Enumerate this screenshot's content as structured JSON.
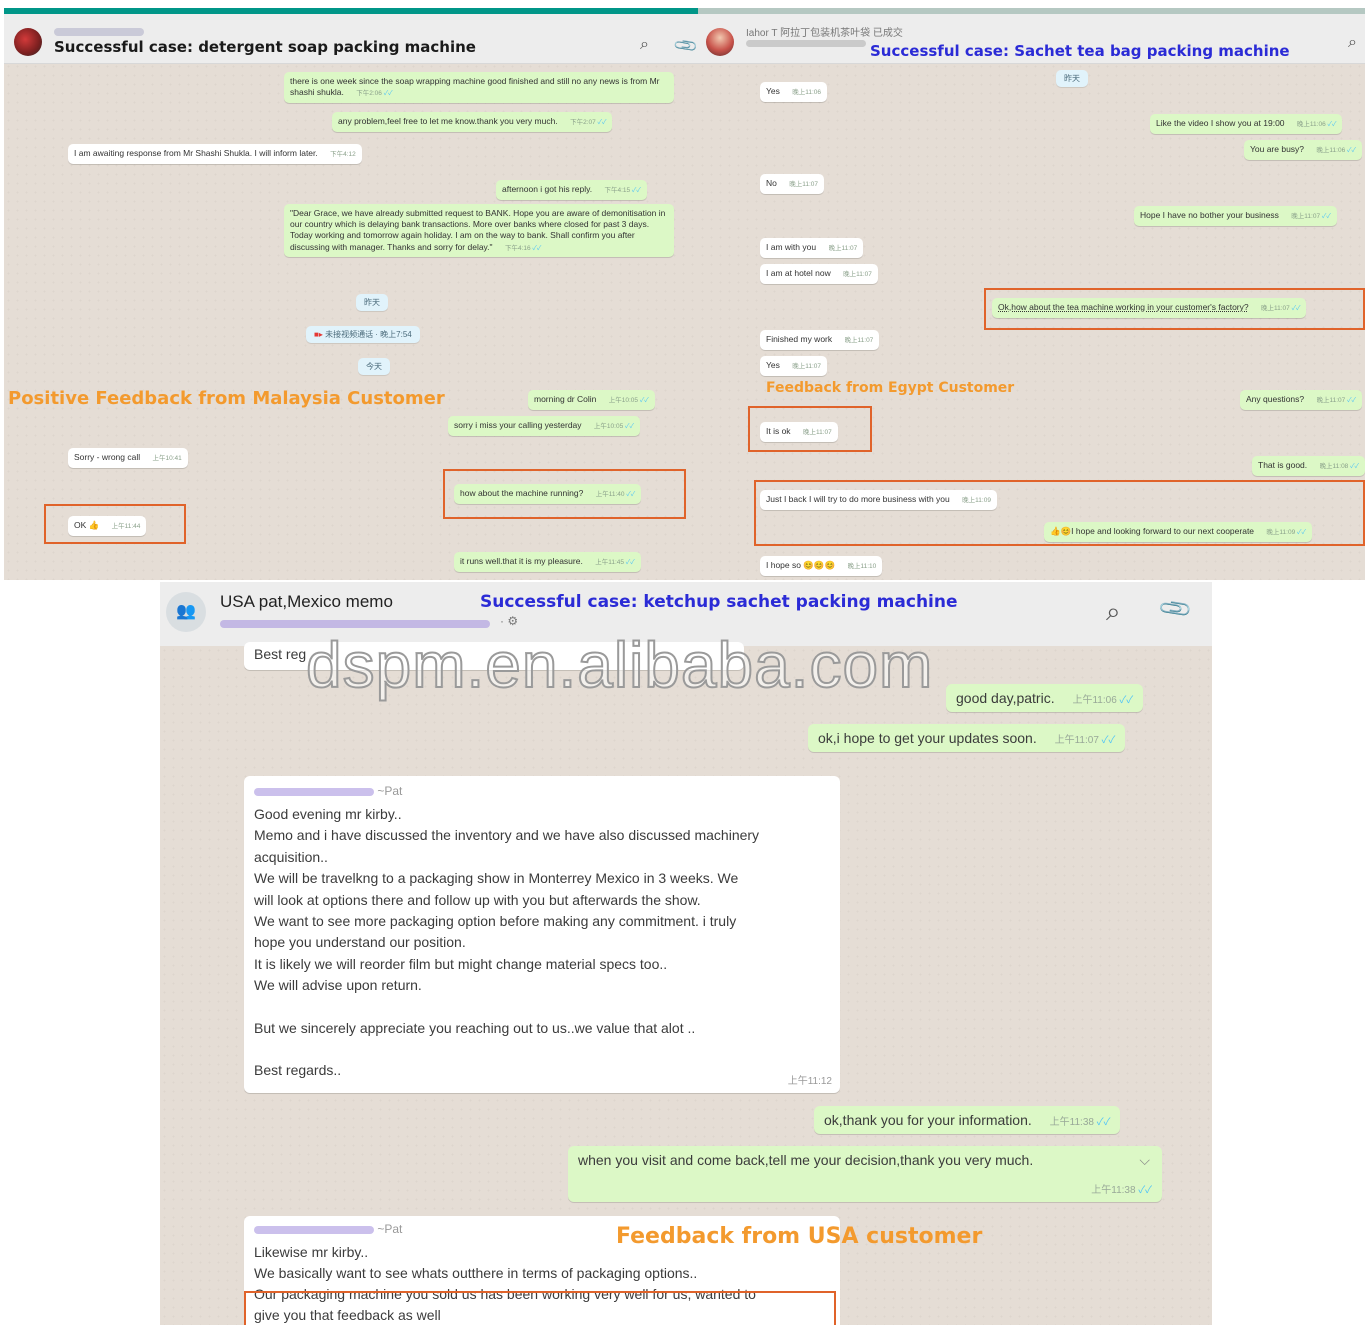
{
  "colors": {
    "outgoing_bubble": "#dcf8c6",
    "incoming_bubble": "#ffffff",
    "chat_background": "#e5ddd5",
    "case_title_blue": "#2b2bd6",
    "feedback_orange": "#f39a2e",
    "highlight_box": "#e0632a",
    "read_ticks": "#4fc3f7"
  },
  "watermark": "dspm.en.alibaba.com",
  "panel_malaysia": {
    "title": "Successful case: detergent soap packing machine",
    "icons": [
      "search-icon",
      "paperclip-icon"
    ],
    "feedback_label": "Positive Feedback from Malaysia Customer",
    "messages": [
      {
        "dir": "out",
        "text": "there is one week since the soap wrapping machine good finished and still no any news is from Mr shashi shukla.",
        "time": "下午2:06"
      },
      {
        "dir": "out",
        "text": "any problem,feel free to let me know.thank you very much.",
        "time": "下午2:07"
      },
      {
        "dir": "in",
        "text": "I am awaiting response from Mr Shashi Shukla. I will inform later.",
        "time": "下午4:12"
      },
      {
        "dir": "out",
        "text": "afternoon i got his reply.",
        "time": "下午4:15"
      },
      {
        "dir": "out",
        "text": "\"Dear Grace, we have already submitted request to BANK. Hope you are aware of demonitisation in our country which is delaying bank transactions. More over banks where closed for past 3 days. Today working and tomorrow again holiday. I am on the way to bank. Shall confirm you after discussing with manager. Thanks and sorry for delay.\"",
        "time": "下午4:16"
      },
      {
        "dir": "out",
        "text": "morning dr Colin",
        "time": "上午10:05"
      },
      {
        "dir": "out",
        "text": "sorry i miss your calling yesterday",
        "time": "上午10:05"
      },
      {
        "dir": "in",
        "text": "Sorry - wrong call",
        "time": "上午10:41"
      },
      {
        "dir": "out",
        "text": "how about the machine running?",
        "time": "上午11:40"
      },
      {
        "dir": "in",
        "text": "OK 👍",
        "time": "上午11:44"
      },
      {
        "dir": "out",
        "text": "it runs well.that it is my pleasure.",
        "time": "上午11:45"
      }
    ],
    "system_chips": [
      "昨天",
      "未接视频通话 · 晚上7:54",
      "今天"
    ]
  },
  "panel_egypt": {
    "contact_name": "Iahor T 阿拉丁包装机茶叶袋 已成交",
    "title": "Successful case: Sachet tea bag packing machine",
    "icons": [
      "search-icon"
    ],
    "feedback_label": "Feedback from Egypt Customer",
    "system_chips": [
      "昨天"
    ],
    "messages": [
      {
        "dir": "in",
        "text": "Yes",
        "time": "晚上11:06"
      },
      {
        "dir": "out",
        "text": "Like the video I show you at 19:00",
        "time": "晚上11:06"
      },
      {
        "dir": "out",
        "text": "You are busy?",
        "time": "晚上11:06"
      },
      {
        "dir": "in",
        "text": "No",
        "time": "晚上11:07"
      },
      {
        "dir": "out",
        "text": "Hope I have no bother your business",
        "time": "晚上11:07"
      },
      {
        "dir": "in",
        "text": "I am with you",
        "time": "晚上11:07"
      },
      {
        "dir": "in",
        "text": "I am at hotel now",
        "time": "晚上11:07"
      },
      {
        "dir": "out",
        "text": "Ok,how about the tea machine working in your customer's factory?",
        "time": "晚上11:07"
      },
      {
        "dir": "in",
        "text": "Finished my work",
        "time": "晚上11:07"
      },
      {
        "dir": "in",
        "text": "Yes",
        "time": "晚上11:07"
      },
      {
        "dir": "out",
        "text": "Any questions?",
        "time": "晚上11:07"
      },
      {
        "dir": "in",
        "text": "It is ok",
        "time": "晚上11:07"
      },
      {
        "dir": "out",
        "text": "That is good.",
        "time": "晚上11:08"
      },
      {
        "dir": "in",
        "text": "Just I back I will try to do more business with you",
        "time": "晚上11:09"
      },
      {
        "dir": "out",
        "text": "👍😊I hope and looking forward to our next cooperate",
        "time": "晚上11:09"
      },
      {
        "dir": "in",
        "text": "I hope so 😊😊😊",
        "time": "晚上11:10"
      }
    ]
  },
  "panel_usa": {
    "contact_name": "USA pat,Mexico memo",
    "title": "Successful case: ketchup sachet packing machine",
    "icons": [
      "search-icon",
      "paperclip-icon"
    ],
    "feedback_label": "Feedback from USA customer",
    "messages": {
      "best_regards_partial": "Best reg",
      "out1": {
        "text": "good day,patric.",
        "time": "上午11:06"
      },
      "out2": {
        "text": "ok,i hope to get your updates soon.",
        "time": "上午11:07"
      },
      "letter": {
        "sender_suffix": "~Pat",
        "lines": [
          "Good evening mr kirby..",
          "Memo and i have discussed the inventory and we have also discussed machinery",
          "acquisition..",
          "We will be travelkng to a packaging show in Monterrey Mexico in 3 weeks. We",
          "will look at options there and follow up with you but afterwards the show.",
          "We want to see more packaging option before making any commitment. i truly",
          "hope you understand our position.",
          "It is likely we will reorder film but might change material specs too..",
          "We will advise upon return.",
          "",
          "But we sincerely appreciate you reaching out to us..we value that alot ..",
          "",
          "Best regards.."
        ],
        "time": "上午11:12"
      },
      "out3": {
        "text": "ok,thank you for your information.",
        "time": "上午11:38"
      },
      "out4": {
        "text": "when you visit and come back,tell me your decision,thank you very much.",
        "time": "上午11:38"
      },
      "reply": {
        "sender_suffix": "~Pat",
        "line1": "Likewise mr kirby..",
        "line2": "We basically want to see whats outthere in terms of packaging options..",
        "highlight_line1": "Our packaging machine you sold us has been working very well for us, wanted to",
        "highlight_line2": "give you that feedback as well"
      }
    }
  }
}
